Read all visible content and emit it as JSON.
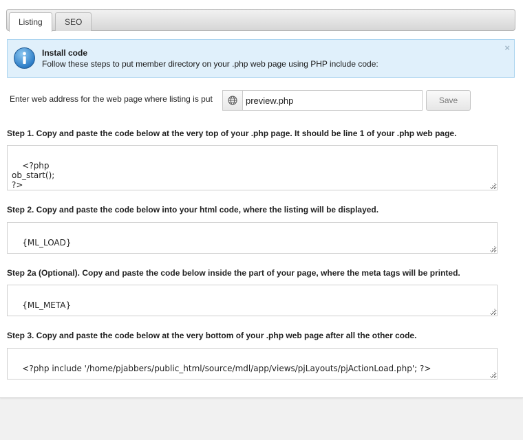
{
  "tabs": [
    {
      "label": "Listing",
      "active": true
    },
    {
      "label": "SEO",
      "active": false
    }
  ],
  "notice": {
    "icon": "info-icon",
    "title": "Install code",
    "text": "Follow these steps to put member directory on your .php web page using PHP include code:"
  },
  "address": {
    "label": "Enter web address for the web page where listing is put",
    "value": "preview.php",
    "icon": "globe-icon",
    "save_label": "Save"
  },
  "steps": [
    {
      "label": "Step 1. Copy and paste the code below at the very top of your .php page. It should be line 1 of your .php web page.",
      "code": "<?php\nob_start();\n?>"
    },
    {
      "label": "Step 2. Copy and paste the code below into your html code, where the listing will be displayed.",
      "code": "{ML_LOAD}"
    },
    {
      "label": "Step 2a (Optional). Copy and paste the code below inside the part of your page, where the meta tags will be printed.",
      "code": "{ML_META}"
    },
    {
      "label": "Step 3. Copy and paste the code below at the very bottom of your .php web page after all the other code.",
      "code": "<?php include '/home/pjabbers/public_html/source/mdl/app/views/pjLayouts/pjActionLoad.php'; ?>"
    }
  ],
  "colors": {
    "notice_bg": "#e0f0fb",
    "notice_border": "#a9d3ef",
    "info_icon": "#2f7fc8"
  }
}
